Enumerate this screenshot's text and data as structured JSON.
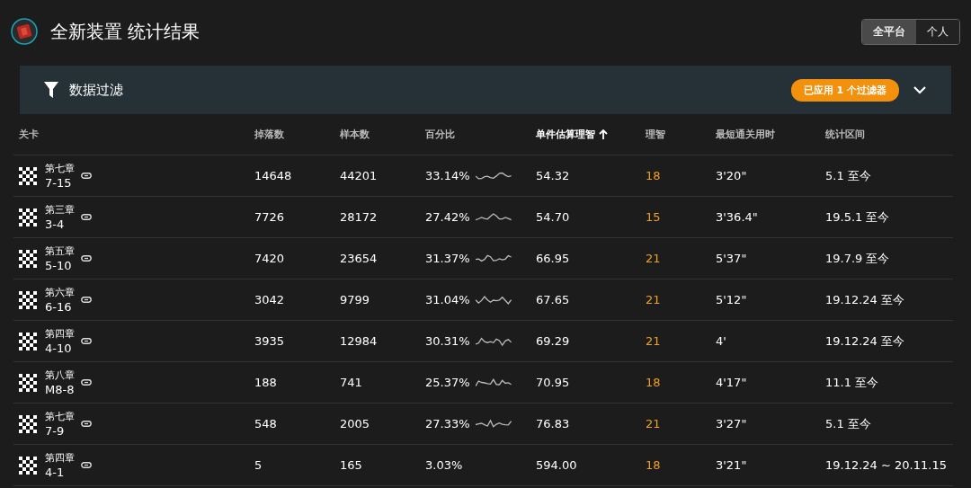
{
  "page": {
    "title": "全新装置 统计结果"
  },
  "scope_toggle": [
    {
      "label": "全平台",
      "selected": true
    },
    {
      "label": "个人",
      "selected": false
    }
  ],
  "filter_panel": {
    "title": "数据过滤",
    "badge": "已应用 1 个过滤器",
    "expanded": false
  },
  "table": {
    "columns": [
      {
        "label": "关卡",
        "sorted": false
      },
      {
        "label": "掉落数",
        "sorted": false
      },
      {
        "label": "样本数",
        "sorted": false
      },
      {
        "label": "百分比",
        "sorted": false
      },
      {
        "label": "单件估算理智",
        "sorted": true
      },
      {
        "label": "理智",
        "sorted": false
      },
      {
        "label": "最短通关用时",
        "sorted": false
      },
      {
        "label": "统计区间",
        "sorted": false
      }
    ],
    "rows": [
      {
        "chapter": "第七章",
        "stage": "7-15",
        "drops": "14648",
        "samples": "44201",
        "percent": "33.14%",
        "trend": true,
        "cost": "54.32",
        "sanity": "18",
        "time": "3'20\"",
        "range": "5.1 至今"
      },
      {
        "chapter": "第三章",
        "stage": "3-4",
        "drops": "7726",
        "samples": "28172",
        "percent": "27.42%",
        "trend": true,
        "cost": "54.70",
        "sanity": "15",
        "time": "3'36.4\"",
        "range": "19.5.1 至今"
      },
      {
        "chapter": "第五章",
        "stage": "5-10",
        "drops": "7420",
        "samples": "23654",
        "percent": "31.37%",
        "trend": true,
        "cost": "66.95",
        "sanity": "21",
        "time": "5'37\"",
        "range": "19.7.9 至今"
      },
      {
        "chapter": "第六章",
        "stage": "6-16",
        "drops": "3042",
        "samples": "9799",
        "percent": "31.04%",
        "trend": true,
        "cost": "67.65",
        "sanity": "21",
        "time": "5'12\"",
        "range": "19.12.24 至今"
      },
      {
        "chapter": "第四章",
        "stage": "4-10",
        "drops": "3935",
        "samples": "12984",
        "percent": "30.31%",
        "trend": true,
        "cost": "69.29",
        "sanity": "21",
        "time": "4'",
        "range": "19.12.24 至今"
      },
      {
        "chapter": "第八章",
        "stage": "M8-8",
        "drops": "188",
        "samples": "741",
        "percent": "25.37%",
        "trend": true,
        "cost": "70.95",
        "sanity": "18",
        "time": "4'17\"",
        "range": "11.1 至今"
      },
      {
        "chapter": "第七章",
        "stage": "7-9",
        "drops": "548",
        "samples": "2005",
        "percent": "27.33%",
        "trend": true,
        "cost": "76.83",
        "sanity": "21",
        "time": "3'27\"",
        "range": "5.1 至今"
      },
      {
        "chapter": "第四章",
        "stage": "4-1",
        "drops": "5",
        "samples": "165",
        "percent": "3.03%",
        "trend": false,
        "cost": "594.00",
        "sanity": "18",
        "time": "3'21\"",
        "range": "19.12.24 ~ 20.11.15"
      }
    ]
  }
}
